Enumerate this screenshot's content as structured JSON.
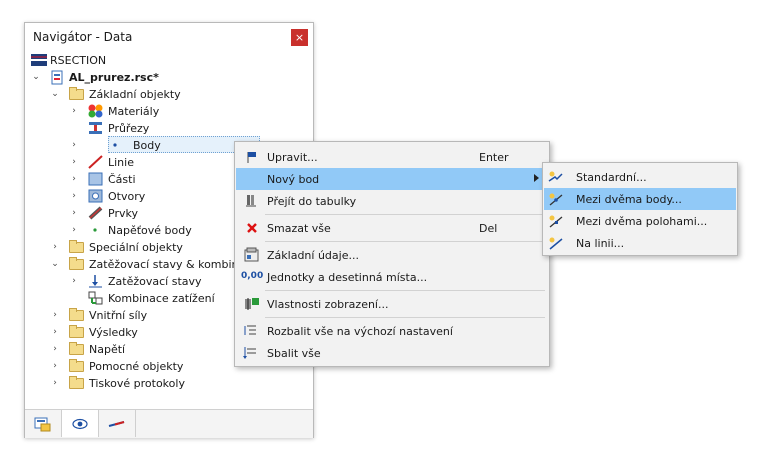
{
  "window": {
    "title": "Navigátor - Data",
    "close_glyph": "×"
  },
  "tree": {
    "root": "RSECTION",
    "file": "AL_prurez.rsc*",
    "basic_objects": "Základní objekty",
    "materials": "Materiály",
    "sections": "Průřezy",
    "points": "Body",
    "lines": "Linie",
    "parts": "Části",
    "openings": "Otvory",
    "elements": "Prvky",
    "stress_points": "Napěťové body",
    "special_objects": "Speciální objekty",
    "load_cases_combinations": "Zatěžovací stavy & kombinace",
    "load_cases": "Zatěžovací stavy",
    "load_combinations": "Kombinace zatížení",
    "internal_forces": "Vnitřní síly",
    "results": "Výsledky",
    "stresses": "Napětí",
    "helper_objects": "Pomocné objekty",
    "print_reports": "Tiskové protokoly"
  },
  "context_menu": {
    "edit": "Upravit...",
    "edit_shortcut": "Enter",
    "new_point": "Nový bod",
    "goto_table": "Přejít do tabulky",
    "delete_all": "Smazat vše",
    "delete_shortcut": "Del",
    "basic_data": "Základní údaje...",
    "units_decimals": "Jednotky a desetinná místa...",
    "display_properties": "Vlastnosti zobrazení...",
    "expand_default": "Rozbalit vše na výchozí nastavení",
    "collapse_all": "Sbalit vše"
  },
  "submenu": {
    "standard": "Standardní...",
    "between_two_points": "Mezi dvěma body...",
    "between_two_positions": "Mezi dvěma polohami...",
    "on_line": "Na linii..."
  },
  "icons": {
    "units_icon_text": "0,00"
  },
  "colors": {
    "highlight": "#91c9f7",
    "selection": "#e5f1fb",
    "close_button": "#c9302c",
    "menu_background": "#f2f2f2"
  }
}
